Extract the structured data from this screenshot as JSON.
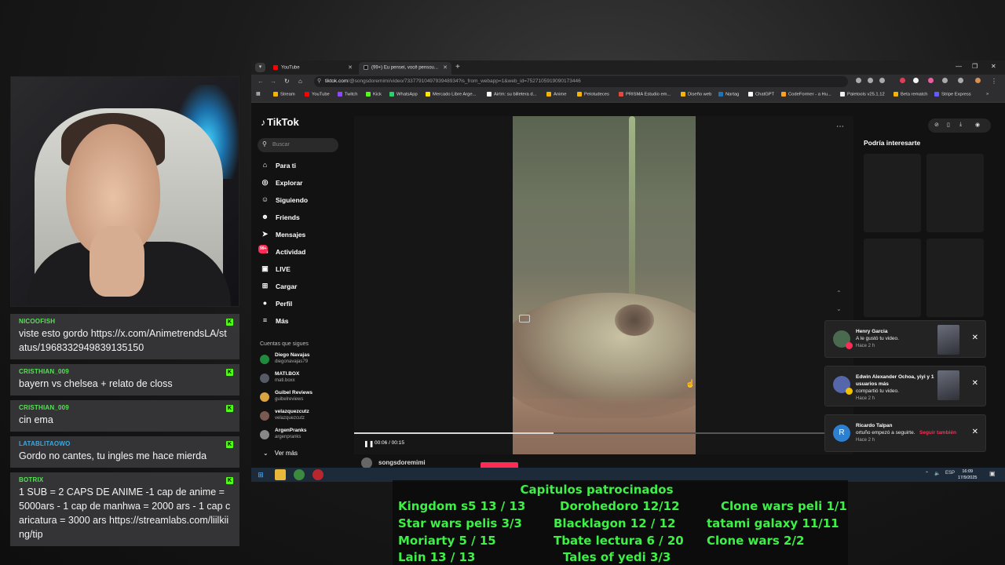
{
  "chat": [
    {
      "user": "NICOOFISH",
      "color": "green",
      "text": "viste esto gordo https://x.com/AnimetrendsLA/status/1968332949839135150"
    },
    {
      "user": "CRISTHIAN_009",
      "color": "green",
      "text": "bayern vs chelsea + relato de closs"
    },
    {
      "user": "CRISTHIAN_009",
      "color": "green",
      "text": "cin ema"
    },
    {
      "user": "LATABLITAOWO",
      "color": "blue",
      "text": "Gordo no cantes, tu ingles me hace mierda"
    },
    {
      "user": "BOTRIX",
      "color": "green",
      "text": "1 SUB = 2 CAPS DE ANIME -1 cap de anime = 5000ars - 1 cap de manhwa = 2000 ars - 1 cap caricatura = 3000 ars https://streamlabs.com/liilkiing/tip"
    }
  ],
  "browser": {
    "tabs": [
      {
        "label": "YouTube",
        "color": "#ff0000"
      },
      {
        "label": "(99+) Eu pensei, você pensou...",
        "color": "#111111"
      }
    ],
    "url_main": "tiktok.com",
    "url_rest": "/@songsdoremimi/video/7337791049793948934?is_from_webapp=1&web_id=7527105919090173446",
    "bookmarks": [
      {
        "label": "Stream",
        "color": "#f4b400"
      },
      {
        "label": "YouTube",
        "color": "#ff0000"
      },
      {
        "label": "Twitch",
        "color": "#9146ff"
      },
      {
        "label": "Kick",
        "color": "#53fc18"
      },
      {
        "label": "WhatsApp",
        "color": "#25d366"
      },
      {
        "label": "Mercado Libre Arge...",
        "color": "#ffe600"
      },
      {
        "label": "Airtm: su billetera d...",
        "color": "#ffffff"
      },
      {
        "label": "Anime",
        "color": "#f4b400"
      },
      {
        "label": "Pelotudeces",
        "color": "#f4b400"
      },
      {
        "label": "PRISMA Estudio em...",
        "color": "#e8453c"
      },
      {
        "label": "Diseño web",
        "color": "#f4b400"
      },
      {
        "label": "Nartag",
        "color": "#2271b1"
      },
      {
        "label": "ChatGPT",
        "color": "#ffffff"
      },
      {
        "label": "CodeFormer - a Hu...",
        "color": "#ff9f1c"
      },
      {
        "label": "Paletools v25.1.12",
        "color": "#eeeeee"
      },
      {
        "label": "Beta rematch",
        "color": "#f4b400"
      },
      {
        "label": "Stripe Express",
        "color": "#635bff"
      }
    ]
  },
  "tiktok": {
    "logo": "TikTok",
    "search_placeholder": "Buscar",
    "nav": [
      {
        "label": "Para ti",
        "icon": "home-icon",
        "glyph": "⌂"
      },
      {
        "label": "Explorar",
        "icon": "compass-icon",
        "glyph": "◎"
      },
      {
        "label": "Siguiendo",
        "icon": "following-icon",
        "glyph": "☺"
      },
      {
        "label": "Friends",
        "icon": "friends-icon",
        "glyph": "☻"
      },
      {
        "label": "Mensajes",
        "icon": "messages-icon",
        "glyph": "➤"
      },
      {
        "label": "Actividad",
        "icon": "activity-icon",
        "glyph": "▭",
        "badge": "99+"
      },
      {
        "label": "LIVE",
        "icon": "live-icon",
        "glyph": "▣"
      },
      {
        "label": "Cargar",
        "icon": "upload-icon",
        "glyph": "⊞"
      },
      {
        "label": "Perfil",
        "icon": "profile-icon",
        "glyph": "●"
      },
      {
        "label": "Más",
        "icon": "more-icon",
        "glyph": "≡"
      }
    ],
    "following_title": "Cuentas que sigues",
    "accounts": [
      {
        "name": "Diego Navajas",
        "handle": "diegonavajas79",
        "color": "#1f8a3b"
      },
      {
        "name": "MATI.BOX",
        "handle": "mati.boxx",
        "color": "#555a66"
      },
      {
        "name": "Guibel Reviews",
        "handle": "guibelreviews",
        "color": "#d9a441"
      },
      {
        "name": "velazquezcutz",
        "handle": "velazquezcutz",
        "color": "#7a5a50"
      },
      {
        "name": "ArgenPranks",
        "handle": "argenpranks",
        "color": "#888888"
      }
    ],
    "see_more": "Ver más",
    "video_time": "00:06 / 00:15",
    "progress": 0.4,
    "uploader": "songsdoremimi",
    "side_title": "Podría interesarte"
  },
  "notifications": [
    {
      "name": "Henry Garcia",
      "message": "A le gustó tu video.",
      "time": "Hace 2 h"
    },
    {
      "name": "Edwin Alexander Ochoa, yiyi y 1 usuarios más",
      "message": "compartió tu video.",
      "time": "Hace 2 h"
    },
    {
      "name": "Ricardo Talpan",
      "message": "ortuño empezó a seguirte.",
      "time": "Hace 2 h",
      "action": "Seguir también",
      "initial": "R"
    }
  ],
  "taskbar": {
    "lang": "ESP",
    "time": "16:09",
    "date": "17/9/2025"
  },
  "sponsor": {
    "title": "Capitulos patrocinados",
    "col1": [
      "Kingdom s5 13 / 13",
      "Star wars pelis 3/3",
      "Moriarty 5 / 15",
      "Lain 13 / 13"
    ],
    "col2": [
      "Dorohedoro 12/12",
      "Blacklagon 12 / 12",
      "Tbate lectura 6 / 20",
      "Tales of yedi 3/3"
    ],
    "col3": [
      "Clone wars peli 1/1",
      "tatami galaxy 11/11",
      "Clone wars 2/2"
    ]
  }
}
